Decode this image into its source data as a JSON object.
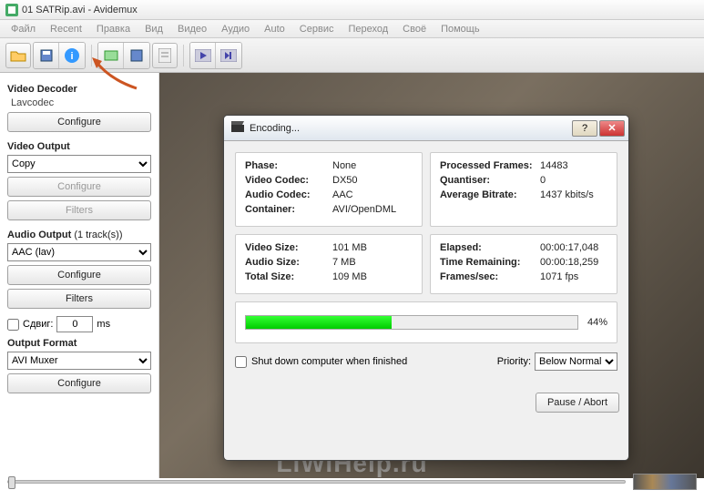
{
  "window": {
    "title": "01 SATRip.avi - Avidemux"
  },
  "menu": [
    "Файл",
    "Recent",
    "Правка",
    "Вид",
    "Видео",
    "Аудио",
    "Auto",
    "Сервис",
    "Переход",
    "Своё",
    "Помощь"
  ],
  "sidebar": {
    "decoder_title": "Video Decoder",
    "decoder_codec": "Lavcodec",
    "configure": "Configure",
    "video_output_title": "Video Output",
    "video_output_value": "Copy",
    "filters": "Filters",
    "audio_output_title": "Audio Output",
    "audio_tracks_suffix": "(1 track(s))",
    "audio_output_value": "AAC (lav)",
    "shift_label": "Сдвиг:",
    "shift_value": "0",
    "shift_unit": "ms",
    "output_format_title": "Output Format",
    "output_format_value": "AVI Muxer"
  },
  "dialog": {
    "title": "Encoding...",
    "left1": [
      {
        "k": "Phase:",
        "v": "None"
      },
      {
        "k": "Video Codec:",
        "v": "DX50"
      },
      {
        "k": "Audio Codec:",
        "v": "AAC"
      },
      {
        "k": "Container:",
        "v": "AVI/OpenDML"
      }
    ],
    "right1": [
      {
        "k": "Processed Frames:",
        "v": "14483"
      },
      {
        "k": "Quantiser:",
        "v": "0"
      },
      {
        "k": "Average Bitrate:",
        "v": "1437 kbits/s"
      }
    ],
    "left2": [
      {
        "k": "Video Size:",
        "v": "101 MB"
      },
      {
        "k": "Audio Size:",
        "v": "7 MB"
      },
      {
        "k": "Total Size:",
        "v": "109 MB"
      }
    ],
    "right2": [
      {
        "k": "Elapsed:",
        "v": "00:00:17,048"
      },
      {
        "k": "Time Remaining:",
        "v": "00:00:18,259"
      },
      {
        "k": "Frames/sec:",
        "v": "1071 fps"
      }
    ],
    "progress_pct": "44%",
    "shutdown_label": "Shut down computer when finished",
    "priority_label": "Priority:",
    "priority_value": "Below Normal",
    "pause_abort": "Pause / Abort"
  },
  "watermark": "LiWiHelp.ru"
}
